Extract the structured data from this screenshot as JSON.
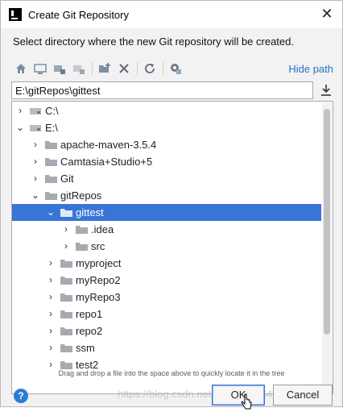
{
  "window": {
    "title": "Create Git Repository",
    "close_glyph": "✕"
  },
  "description": "Select directory where the new Git repository will be created.",
  "toolbar": {
    "hide_path_label": "Hide path",
    "icons": [
      "home-icon",
      "desktop-icon",
      "project-icon",
      "module-icon",
      "new-folder-icon",
      "delete-icon",
      "refresh-icon",
      "show-hidden-icon"
    ]
  },
  "path": {
    "value": "E:\\gitRepos\\gittest"
  },
  "tree": {
    "items": [
      {
        "label": "C:\\",
        "arrow": "›",
        "type": "drive"
      },
      {
        "label": "E:\\",
        "arrow": "⌄",
        "type": "drive"
      },
      {
        "label": "apache-maven-3.5.4",
        "arrow": "›",
        "type": "folder"
      },
      {
        "label": "Camtasia+Studio+5",
        "arrow": "›",
        "type": "folder"
      },
      {
        "label": "Git",
        "arrow": "›",
        "type": "folder"
      },
      {
        "label": "gitRepos",
        "arrow": "⌄",
        "type": "folder"
      },
      {
        "label": "gittest",
        "arrow": "⌄",
        "type": "folder",
        "selected": true
      },
      {
        "label": ".idea",
        "arrow": "›",
        "type": "folder"
      },
      {
        "label": "src",
        "arrow": "›",
        "type": "folder"
      },
      {
        "label": "myproject",
        "arrow": "›",
        "type": "folder"
      },
      {
        "label": "myRepo2",
        "arrow": "›",
        "type": "folder"
      },
      {
        "label": "myRepo3",
        "arrow": "›",
        "type": "folder"
      },
      {
        "label": "repo1",
        "arrow": "›",
        "type": "folder"
      },
      {
        "label": "repo2",
        "arrow": "›",
        "type": "folder"
      },
      {
        "label": "ssm",
        "arrow": "›",
        "type": "folder"
      },
      {
        "label": "test2",
        "arrow": "›",
        "type": "folder"
      }
    ]
  },
  "hint": "Drag and drop a file into the space above to quickly locate it in the tree",
  "buttons": {
    "help_glyph": "?",
    "ok_label": "OK",
    "cancel_label": "Cancel"
  },
  "watermark": "https://blog.csdn.net/qq_4104464",
  "colors": {
    "selection": "#3875d7",
    "link": "#2770c6",
    "help": "#2d7bd4"
  }
}
